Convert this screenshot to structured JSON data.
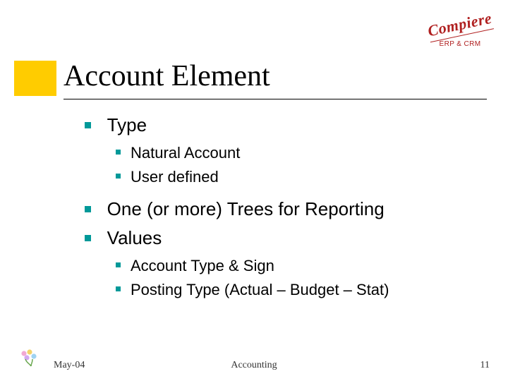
{
  "logo": {
    "name": "Compiere",
    "subtitle": "ERP & CRM"
  },
  "title": "Account Element",
  "bullets": [
    {
      "text": "Type",
      "children": [
        {
          "text": "Natural Account"
        },
        {
          "text": "User defined"
        }
      ]
    },
    {
      "text": "One (or more) Trees for Reporting"
    },
    {
      "text": "Values",
      "children": [
        {
          "text": "Account Type & Sign"
        },
        {
          "text": "Posting Type (Actual – Budget – Stat)"
        }
      ]
    }
  ],
  "footer": {
    "date": "May-04",
    "center": "Accounting",
    "page": "11"
  }
}
